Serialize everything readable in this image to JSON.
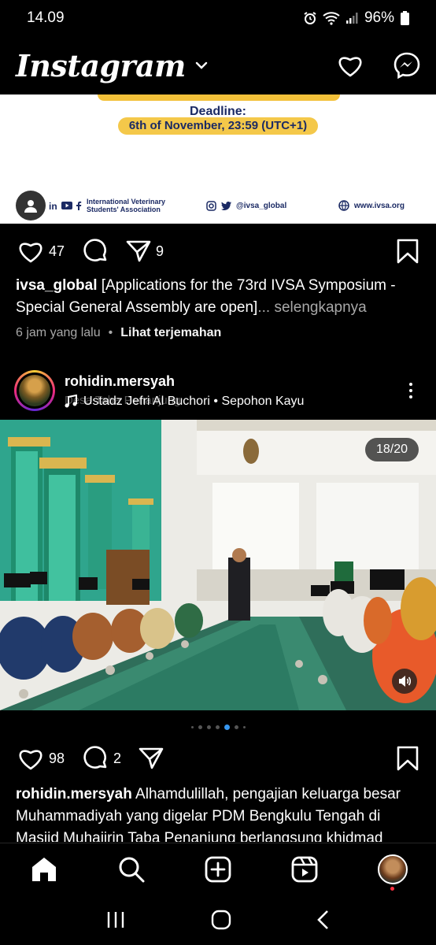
{
  "status_bar": {
    "time": "14.09",
    "battery": "96%"
  },
  "header": {
    "logo": "Instagram"
  },
  "post1": {
    "deadline_label": "Deadline:",
    "deadline_value": "6th of November, 23:59 (UTC+1)",
    "org_name": "International Veterinary Students' Association",
    "social_handle": "@ivsa_global",
    "website": "www.ivsa.org",
    "likes": "47",
    "shares": "9",
    "caption_user": "ivsa_global",
    "caption_text": " [Applications for the 73rd IVSA Symposium - Special General Assembly are open]",
    "more_label": "... selengkapnya",
    "time_ago": "6 jam yang lalu",
    "translate_label": "Lihat terjemahan"
  },
  "post2": {
    "username": "rohidin.mersyah",
    "location": "Desa Taba Penanjung",
    "audio": "Ustadz Jefri Al Buchori • Sepohon Kayu",
    "counter": "18/20",
    "likes": "98",
    "comments": "2",
    "caption_user": "rohidin.mersyah",
    "caption_text": " Alhamdulillah, pengajian keluarga besar Muhammadiyah yang digelar PDM Bengkulu Tengah di Masjid Muhajirin Taba Penanjung berlangsung khidmad"
  },
  "colors": {
    "accent": "#3797f0",
    "notification": "#ff3040",
    "banner_yellow": "#f4c84a"
  }
}
